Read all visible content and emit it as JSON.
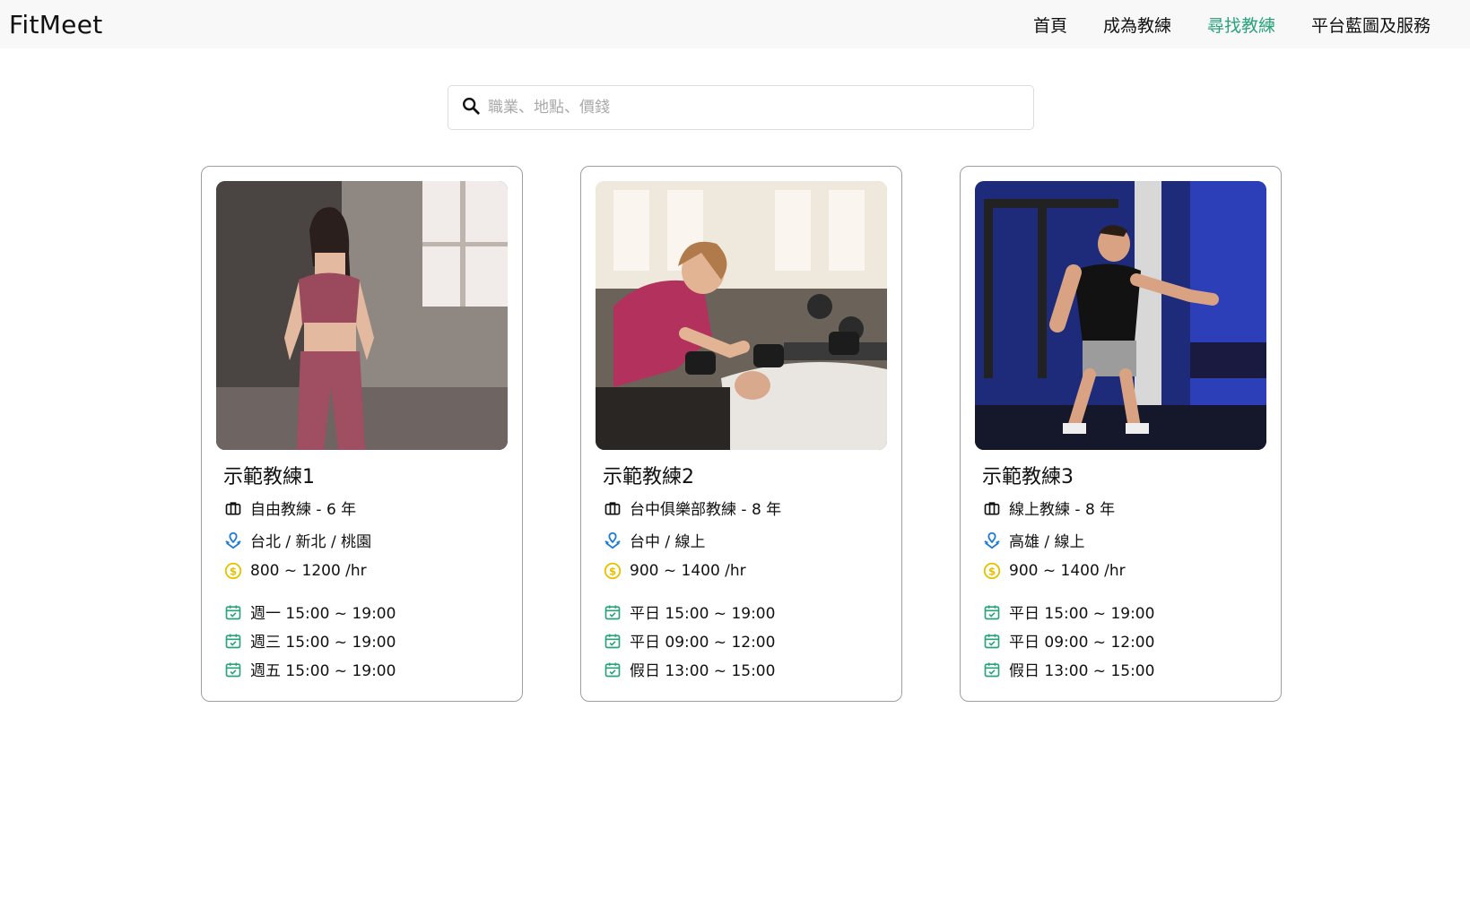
{
  "brand": "FitMeet",
  "nav": {
    "home": "首頁",
    "become_coach": "成為教練",
    "find_coach": "尋找教練",
    "platform": "平台藍圖及服務"
  },
  "search": {
    "placeholder": "職業、地點、價錢"
  },
  "colors": {
    "accent": "#2aa37a",
    "calendar": "#2aa37a",
    "location": "#1e7bd6",
    "price": "#e6c100"
  },
  "icons": {
    "search": "search-icon",
    "job": "briefcase-icon",
    "location": "location-pin-icon",
    "price": "dollar-coin-icon",
    "schedule": "calendar-check-icon"
  },
  "coaches": [
    {
      "name": "示範教練1",
      "job": "自由教練 - 6 年",
      "location": "台北 / 新北 / 桃園",
      "price": "800 ~ 1200 /hr",
      "schedule": [
        "週一 15:00 ~ 19:00",
        "週三 15:00 ~ 19:00",
        "週五 15:00 ~ 19:00"
      ]
    },
    {
      "name": "示範教練2",
      "job": "台中俱樂部教練 - 8 年",
      "location": "台中 / 線上",
      "price": "900 ~ 1400 /hr",
      "schedule": [
        "平日 15:00 ~ 19:00",
        "平日 09:00 ~ 12:00",
        "假日 13:00 ~ 15:00"
      ]
    },
    {
      "name": "示範教練3",
      "job": "線上教練 - 8 年",
      "location": "高雄 / 線上",
      "price": "900 ~ 1400 /hr",
      "schedule": [
        "平日 15:00 ~ 19:00",
        "平日 09:00 ~ 12:00",
        "假日 13:00 ~ 15:00"
      ]
    }
  ]
}
